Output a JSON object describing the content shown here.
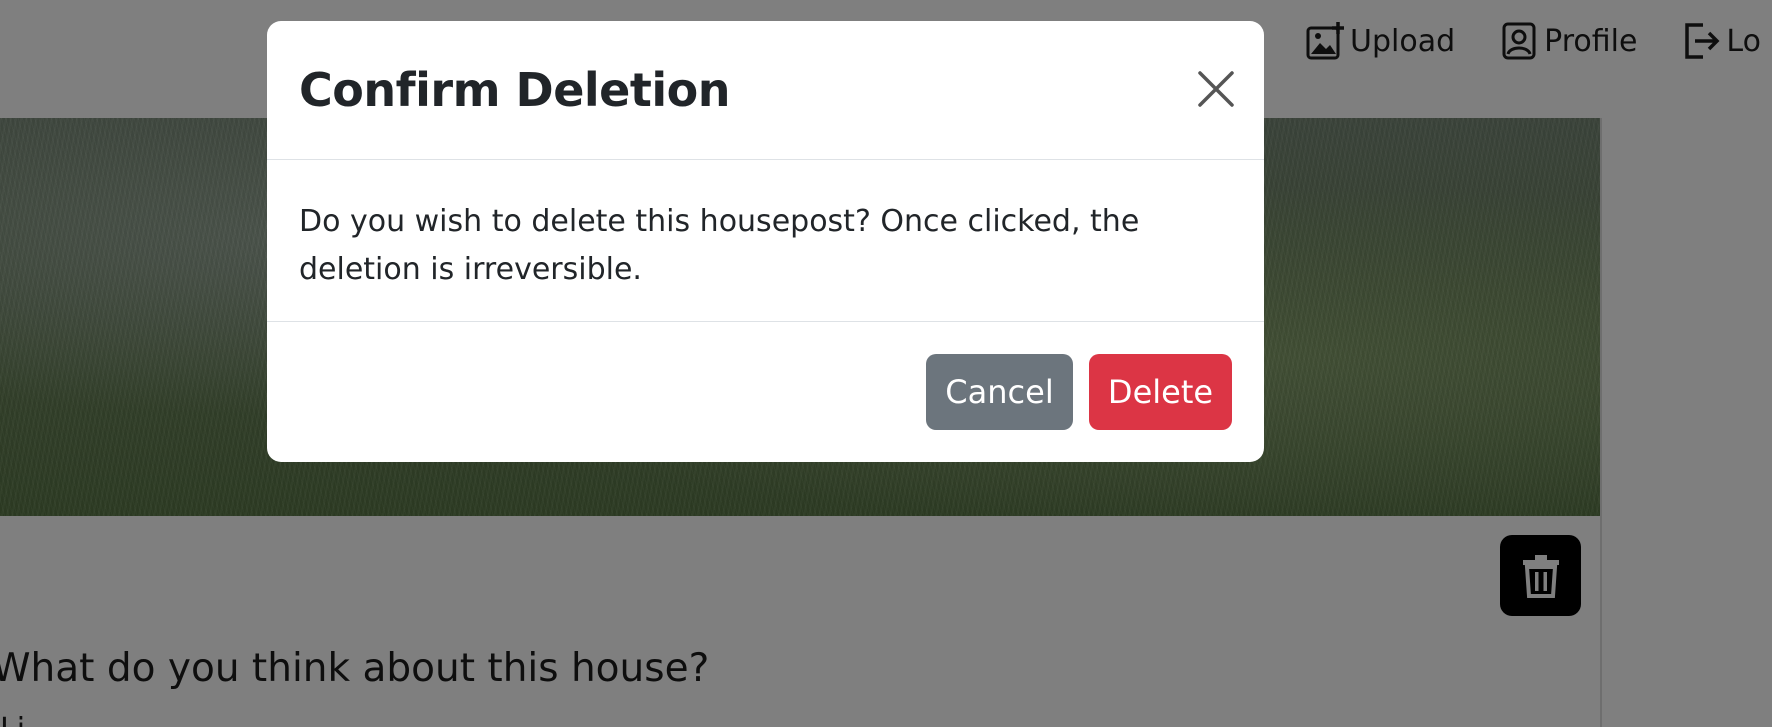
{
  "nav": {
    "upload_label": "Upload",
    "profile_label": "Profile",
    "logout_label": "Lo"
  },
  "post": {
    "question": "What do you think about this house?",
    "subtext": "Li"
  },
  "modal": {
    "title": "Confirm Deletion",
    "message": "Do you wish to delete this housepost? Once clicked, the deletion is irreversible.",
    "cancel_label": "Cancel",
    "delete_label": "Delete"
  },
  "colors": {
    "cancel_button": "#6c757d",
    "delete_button": "#dc3545",
    "backdrop": "rgba(0,0,0,0.5)",
    "trash_button": "#000000"
  },
  "icons": {
    "upload": "image-plus-icon",
    "profile": "person-badge-icon",
    "logout": "box-arrow-right-icon",
    "trash": "trash-icon",
    "close": "close-icon"
  }
}
